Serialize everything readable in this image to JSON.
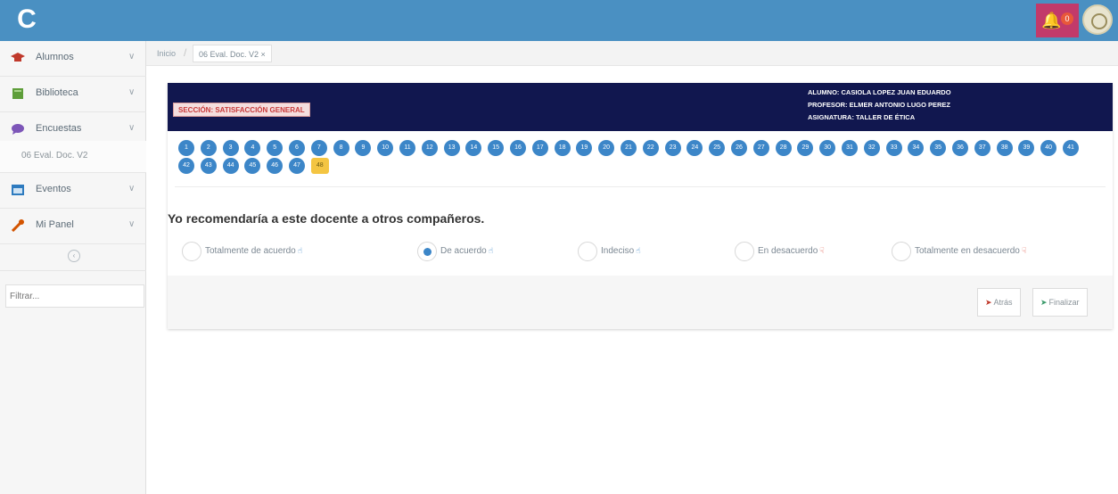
{
  "header": {
    "logo_glyph": "C",
    "bell_icon": "bell-icon",
    "notification_count": "0"
  },
  "sidebar": {
    "items": [
      {
        "label": "Alumnos",
        "icon": "graduation-cap-icon",
        "color": "#c0392b"
      },
      {
        "label": "Biblioteca",
        "icon": "book-icon",
        "color": "#5e9e3a"
      },
      {
        "label": "Encuestas",
        "icon": "chat-bubble-icon",
        "color": "#7d56b8"
      },
      {
        "label": "Eventos",
        "icon": "calendar-icon",
        "color": "#2e7bbf"
      },
      {
        "label": "Mi Panel",
        "icon": "wrench-icon",
        "color": "#d35400"
      }
    ],
    "sub_item": "06 Eval. Doc. V2",
    "search_placeholder": "Filtrar..."
  },
  "breadcrumb": {
    "home": "Inicio",
    "active": "06 Eval. Doc. V2 ×"
  },
  "card": {
    "section_label": "SECCIÓN: SATISFACCIÓN GENERAL",
    "alumno": "ALUMNO: CASIOLA LOPEZ JUAN EDUARDO",
    "profesor": "PROFESOR: ELMER ANTONIO LUGO PEREZ",
    "asignatura": "ASIGNATURA: TALLER DE ÉTICA",
    "question": "Yo recomendaría a este docente a otros compañeros.",
    "options": [
      {
        "label": "Totalmente de acuerdo",
        "icon": "thumbs-up-icon",
        "checked": false
      },
      {
        "label": "De acuerdo",
        "icon": "thumbs-up-icon",
        "checked": true
      },
      {
        "label": "Indeciso",
        "icon": "thumbs-up-icon",
        "checked": false
      },
      {
        "label": "En desacuerdo",
        "icon": "thumbs-down-icon",
        "checked": false
      },
      {
        "label": "Totalmente en desacuerdo",
        "icon": "thumbs-down-icon",
        "checked": false
      }
    ],
    "back_label": "Atrás",
    "finish_label": "Finalizar"
  },
  "questions": {
    "numbers": [
      "1",
      "2",
      "3",
      "4",
      "5",
      "6",
      "7",
      "8",
      "9",
      "10",
      "11",
      "12",
      "13",
      "14",
      "15",
      "16",
      "17",
      "18",
      "19",
      "20",
      "21",
      "22",
      "23",
      "24",
      "25",
      "26",
      "27",
      "28",
      "29",
      "30",
      "31",
      "32",
      "33",
      "34",
      "35",
      "36",
      "37",
      "38",
      "39",
      "40",
      "41",
      "42",
      "43",
      "44",
      "45",
      "46",
      "47",
      "48"
    ],
    "current": "48",
    "colors": {
      "answered": "#3c86c8",
      "current": "#f4c542"
    }
  },
  "colors": {
    "topbar": "#4a90c2",
    "card_header": "#11174f",
    "alert": "#c23a6a"
  }
}
